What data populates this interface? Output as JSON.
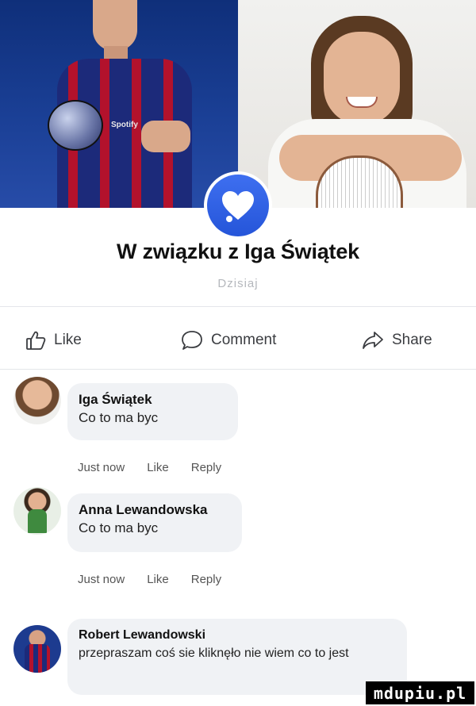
{
  "header": {
    "title": "W związku z Iga Świątek",
    "subtitle": "Dzisiaj"
  },
  "actions": {
    "like": "Like",
    "comment": "Comment",
    "share": "Share"
  },
  "comments": [
    {
      "name": "Iga Świątek",
      "text": "Co to ma byc",
      "time": "Just now",
      "like": "Like",
      "reply": "Reply"
    },
    {
      "name": "Anna Lewandowska",
      "text": "Co to ma byc",
      "time": "Just now",
      "like": "Like",
      "reply": "Reply"
    },
    {
      "name": "Robert Lewandowski",
      "text": "przepraszam coś sie kliknęło nie wiem co to jest"
    }
  ],
  "photo_left": {
    "sponsor": "Spotify"
  },
  "watermark": "mdupiu.pl",
  "colors": {
    "accent": "#2f62e6",
    "bubble": "#f0f2f5",
    "muted": "#b5b8bd"
  }
}
